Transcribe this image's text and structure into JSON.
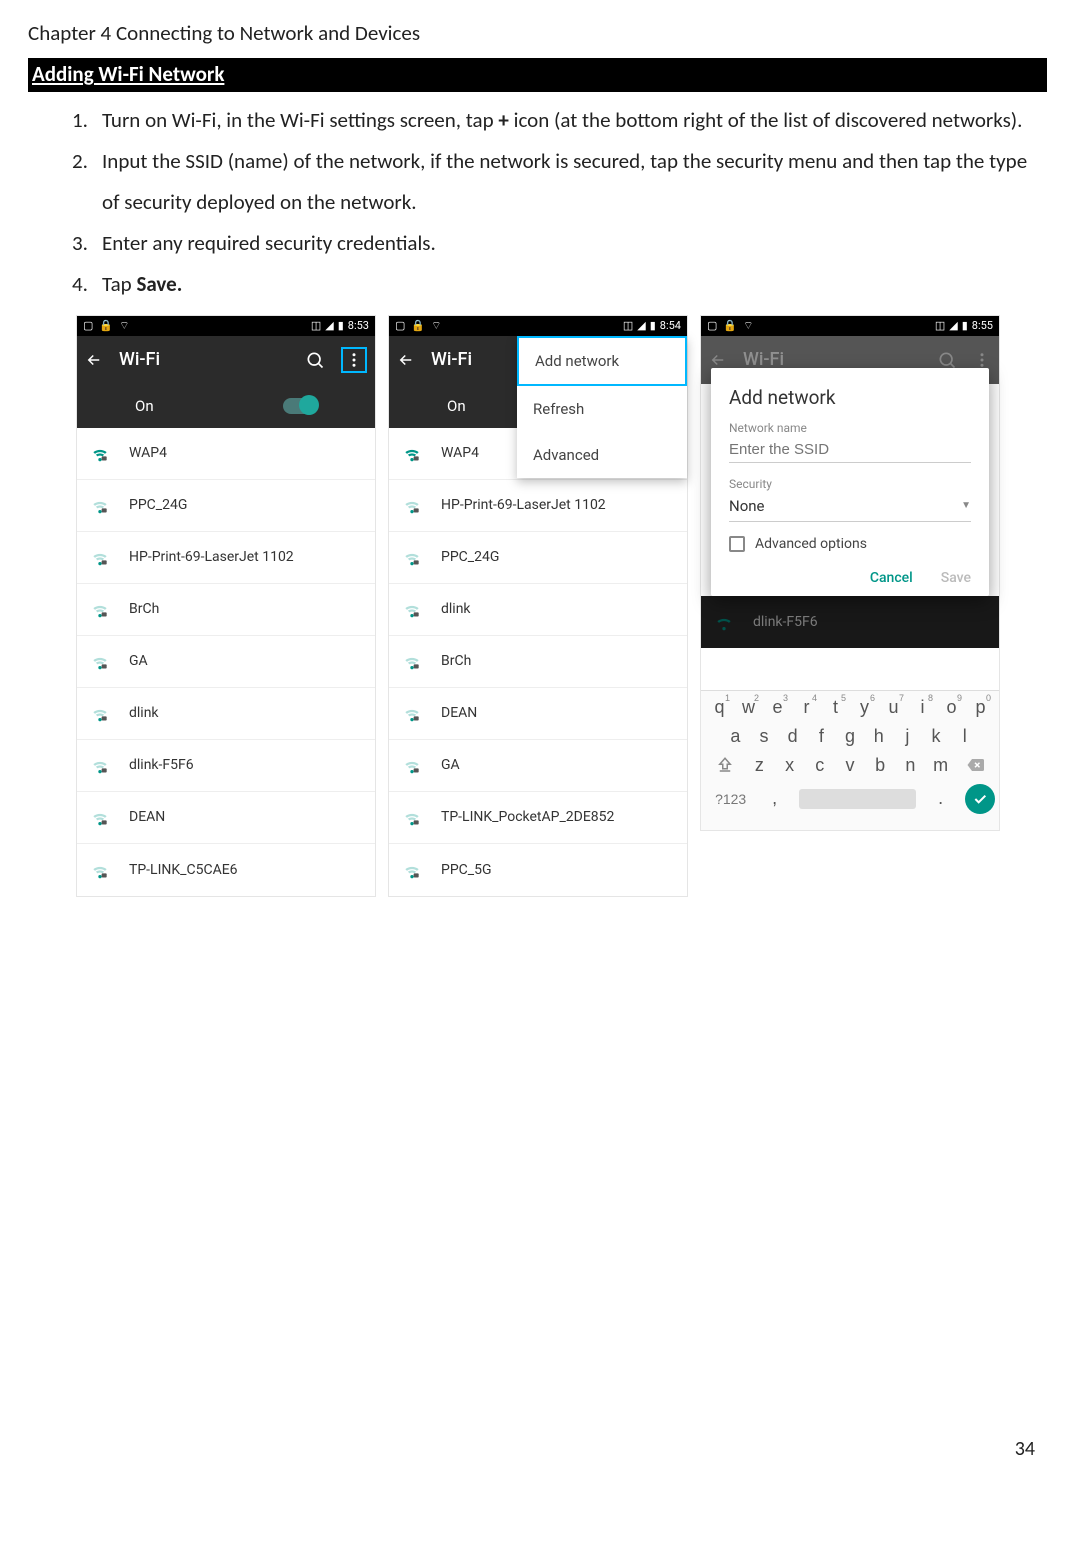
{
  "chapter": "Chapter 4 Connecting to Network and Devices",
  "section": "Adding Wi-Fi Network",
  "steps": [
    {
      "n": "1.",
      "pre": "Turn on Wi-Fi, in the Wi-Fi settings screen, tap ",
      "bold": "+",
      "post": " icon (at the bottom right of the list of discovered networks)."
    },
    {
      "n": "2.",
      "pre": "Input the SSID (name) of the network, if the network is secured, tap the security menu and then tap the type of security deployed on the network.",
      "bold": "",
      "post": ""
    },
    {
      "n": "3.",
      "pre": "Enter any required security credentials.",
      "bold": "",
      "post": ""
    },
    {
      "n": "4.",
      "pre": "Tap ",
      "bold": "Save.",
      "post": ""
    }
  ],
  "shot1": {
    "time": "8:53",
    "title": "Wi-Fi",
    "on": "On",
    "nets": [
      "WAP4",
      "PPC_24G",
      "HP-Print-69-LaserJet 1102",
      "BrCh",
      "GA",
      "dlink",
      "dlink-F5F6",
      "DEAN",
      "TP-LINK_C5CAE6"
    ]
  },
  "shot2": {
    "time": "8:54",
    "title": "Wi-Fi",
    "on": "On",
    "menu": [
      "Add network",
      "Refresh",
      "Advanced"
    ],
    "nets": [
      "WAP4",
      "HP-Print-69-LaserJet 1102",
      "PPC_24G",
      "dlink",
      "BrCh",
      "DEAN",
      "GA",
      "TP-LINK_PocketAP_2DE852",
      "PPC_5G"
    ]
  },
  "shot3": {
    "time": "8:55",
    "title": "Wi-Fi",
    "dialog": {
      "title": "Add network",
      "name_label": "Network name",
      "name_ph": "Enter the SSID",
      "sec_label": "Security",
      "sec_val": "None",
      "adv": "Advanced options",
      "cancel": "Cancel",
      "save": "Save"
    },
    "bg_net": "dlink-F5F6",
    "kb": {
      "r1": [
        "q",
        "w",
        "e",
        "r",
        "t",
        "y",
        "u",
        "i",
        "o",
        "p"
      ],
      "nums": [
        "1",
        "2",
        "3",
        "4",
        "5",
        "6",
        "7",
        "8",
        "9",
        "0"
      ],
      "r2": [
        "a",
        "s",
        "d",
        "f",
        "g",
        "h",
        "j",
        "k",
        "l"
      ],
      "r3": [
        "z",
        "x",
        "c",
        "v",
        "b",
        "n",
        "m"
      ],
      "sym": "?123",
      "comma": ",",
      "dot": "."
    }
  },
  "pagenum": "34"
}
